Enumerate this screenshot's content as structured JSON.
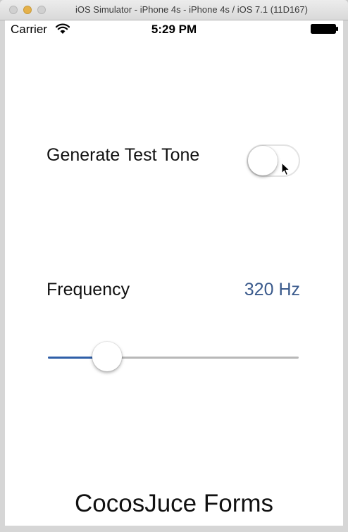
{
  "window": {
    "title": "iOS Simulator - iPhone 4s - iPhone 4s / iOS 7.1 (11D167)"
  },
  "statusbar": {
    "carrier": "Carrier",
    "time": "5:29 PM",
    "icons": [
      "wifi-icon",
      "battery-icon"
    ]
  },
  "tone": {
    "label": "Generate Test Tone",
    "switch_on": false
  },
  "frequency": {
    "label": "Frequency",
    "value_text": "320 Hz",
    "slider_fraction": 0.2
  },
  "footer": {
    "title": "CocosJuce Forms"
  },
  "colors": {
    "accent": "#2f5fa8",
    "value_text": "#3a5a8c",
    "switch_border": "#e3e3e3"
  }
}
